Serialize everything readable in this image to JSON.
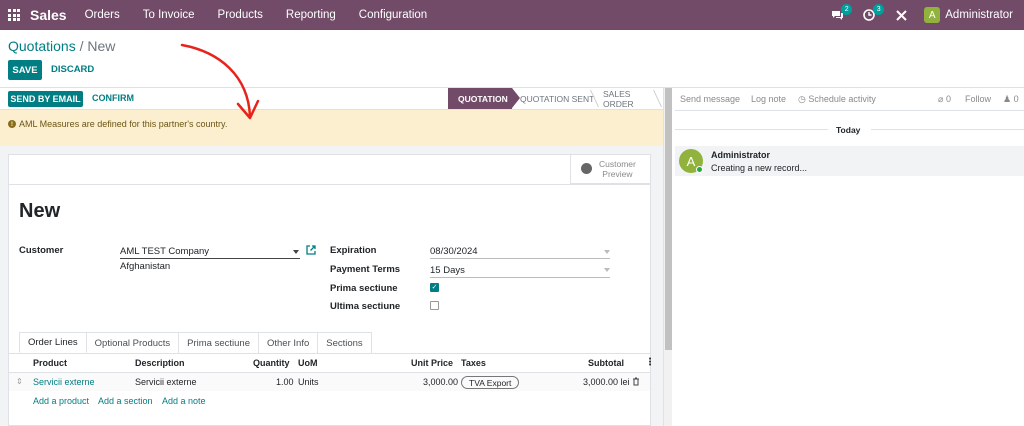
{
  "navbar": {
    "brand": "Sales",
    "menu": [
      "Orders",
      "To Invoice",
      "Products",
      "Reporting",
      "Configuration"
    ],
    "chat_count": "2",
    "activity_count": "3",
    "user_initial": "A",
    "user_name": "Administrator"
  },
  "breadcrumb": {
    "parent": "Quotations",
    "separator": "/",
    "current": "New"
  },
  "control": {
    "save": "SAVE",
    "discard": "DISCARD"
  },
  "statusbar": {
    "send_email": "SEND BY EMAIL",
    "confirm": "CONFIRM",
    "stages": [
      "QUOTATION",
      "QUOTATION SENT",
      "SALES ORDER"
    ],
    "active_stage": "QUOTATION"
  },
  "alert": {
    "icon": "!",
    "text": "AML Measures are defined for this partner's country."
  },
  "form": {
    "preview_line1": "Customer",
    "preview_line2": "Preview",
    "title": "New",
    "customer_label": "Customer",
    "customer_value": "AML TEST Company",
    "customer_address": "Afghanistan",
    "expiration_label": "Expiration",
    "expiration_value": "08/30/2024",
    "payment_terms_label": "Payment Terms",
    "payment_terms_value": "15 Days",
    "prima_label": "Prima sectiune",
    "prima_checked": true,
    "ultima_label": "Ultima sectiune",
    "ultima_checked": false
  },
  "tabs": [
    "Order Lines",
    "Optional Products",
    "Prima sectiune",
    "Other Info",
    "Sections"
  ],
  "table": {
    "headers": {
      "product": "Product",
      "description": "Description",
      "quantity": "Quantity",
      "uom": "UoM",
      "unit_price": "Unit Price",
      "taxes": "Taxes",
      "subtotal": "Subtotal"
    },
    "rows": [
      {
        "product": "Servicii externe",
        "description": "Servicii externe",
        "quantity": "1.00",
        "uom": "Units",
        "unit_price": "3,000.00",
        "tax": "TVA Export",
        "subtotal": "3,000.00 lei"
      }
    ],
    "add_product": "Add a product",
    "add_section": "Add a section",
    "add_note": "Add a note"
  },
  "chatter": {
    "send_message": "Send message",
    "log_note": "Log note",
    "schedule_activity": "Schedule activity",
    "attachments": "0",
    "follow": "Follow",
    "followers": "0",
    "today": "Today",
    "message": {
      "avatar": "A",
      "author": "Administrator",
      "body": "Creating a new record..."
    }
  },
  "colors": {
    "brand": "#714b67",
    "primary": "#017e84",
    "alert_bg": "#fcefcf",
    "annotation": "#e8231c"
  }
}
